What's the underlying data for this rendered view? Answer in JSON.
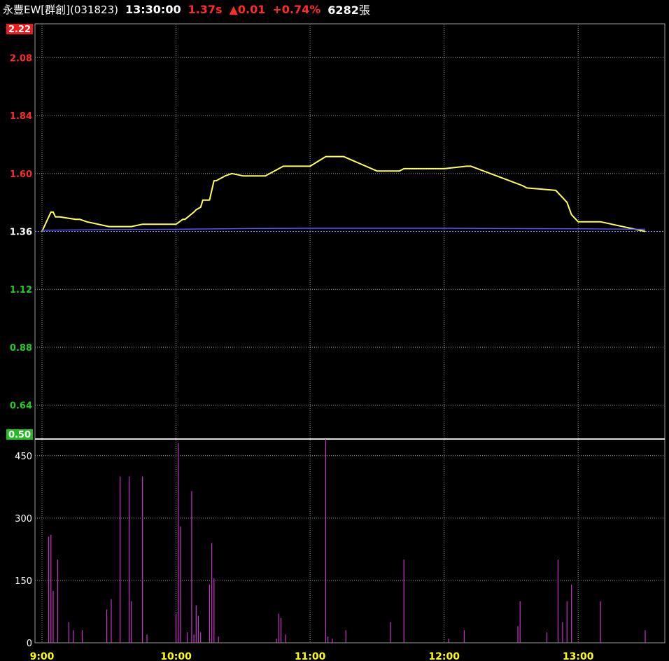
{
  "header": {
    "name": "永豐EW[群創](031823)",
    "time": "13:30:00",
    "price": "1.37s",
    "change_arrow": "▲",
    "change": "0.01",
    "change_pct": "+0.74%",
    "volume": "6282",
    "volume_unit": "張"
  },
  "colors": {
    "up": "#ff2a2a",
    "down": "#22cc22",
    "price_line": "#ffff55",
    "avg_line": "#5555ff",
    "volume_bar": "#cc33cc",
    "grid": "#9a9a9a"
  },
  "chart_data": [
    {
      "type": "line",
      "title": "",
      "x_ticks": [
        "9:00",
        "10:00",
        "11:00",
        "12:00",
        "13:00"
      ],
      "y_ticks": [
        "2.22",
        "2.08",
        "1.84",
        "1.60",
        "1.36",
        "1.12",
        "0.88",
        "0.64",
        "0.50"
      ],
      "ylim": [
        0.5,
        2.22
      ],
      "reference": 1.36,
      "grid": true,
      "series": [
        {
          "role": "price",
          "x": [
            "9:00",
            "9:02",
            "9:04",
            "9:05",
            "9:06",
            "9:08",
            "9:15",
            "9:17",
            "9:20",
            "9:30",
            "9:40",
            "9:45",
            "9:50",
            "10:00",
            "10:03",
            "10:04",
            "10:08",
            "10:09",
            "10:11",
            "10:12",
            "10:15",
            "10:17",
            "10:18",
            "10:22",
            "10:25",
            "10:30",
            "10:40",
            "10:48",
            "10:50",
            "11:00",
            "11:07",
            "11:08",
            "11:15",
            "11:30",
            "11:40",
            "11:42",
            "12:00",
            "12:10",
            "12:12",
            "12:35",
            "12:37",
            "12:50",
            "12:55",
            "12:57",
            "12:59",
            "13:00",
            "13:10",
            "13:30"
          ],
          "values": [
            1.36,
            1.4,
            1.44,
            1.44,
            1.42,
            1.42,
            1.41,
            1.41,
            1.4,
            1.38,
            1.38,
            1.39,
            1.39,
            1.39,
            1.41,
            1.41,
            1.44,
            1.45,
            1.46,
            1.49,
            1.49,
            1.57,
            1.57,
            1.59,
            1.6,
            1.59,
            1.59,
            1.63,
            1.63,
            1.63,
            1.67,
            1.67,
            1.67,
            1.61,
            1.61,
            1.62,
            1.62,
            1.63,
            1.63,
            1.55,
            1.54,
            1.53,
            1.48,
            1.43,
            1.41,
            1.4,
            1.4,
            1.36
          ]
        },
        {
          "role": "average",
          "x": [
            "9:00",
            "9:30",
            "10:00",
            "10:30",
            "11:00",
            "11:30",
            "12:00",
            "12:30",
            "13:00",
            "13:30"
          ],
          "values": [
            1.365,
            1.368,
            1.369,
            1.372,
            1.373,
            1.373,
            1.373,
            1.372,
            1.371,
            1.369
          ]
        }
      ]
    },
    {
      "type": "bar",
      "role": "volume",
      "y_ticks": [
        "450",
        "300",
        "150",
        "0"
      ],
      "ylim": [
        0,
        490
      ],
      "bars": [
        {
          "t": "9:03",
          "v": 255
        },
        {
          "t": "9:04",
          "v": 260
        },
        {
          "t": "9:05",
          "v": 125
        },
        {
          "t": "9:07",
          "v": 200
        },
        {
          "t": "9:12",
          "v": 50
        },
        {
          "t": "9:14",
          "v": 30
        },
        {
          "t": "9:18",
          "v": 30
        },
        {
          "t": "9:29",
          "v": 80
        },
        {
          "t": "9:31",
          "v": 105
        },
        {
          "t": "9:35",
          "v": 400
        },
        {
          "t": "9:39",
          "v": 400
        },
        {
          "t": "9:40",
          "v": 100
        },
        {
          "t": "9:45",
          "v": 400
        },
        {
          "t": "9:47",
          "v": 20
        },
        {
          "t": "10:00",
          "v": 70
        },
        {
          "t": "10:01",
          "v": 480
        },
        {
          "t": "10:02",
          "v": 280
        },
        {
          "t": "10:05",
          "v": 25
        },
        {
          "t": "10:07",
          "v": 365
        },
        {
          "t": "10:08",
          "v": 20
        },
        {
          "t": "10:09",
          "v": 90
        },
        {
          "t": "10:10",
          "v": 65
        },
        {
          "t": "10:11",
          "v": 25
        },
        {
          "t": "10:15",
          "v": 140
        },
        {
          "t": "10:16",
          "v": 240
        },
        {
          "t": "10:17",
          "v": 155
        },
        {
          "t": "10:19",
          "v": 15
        },
        {
          "t": "10:45",
          "v": 10
        },
        {
          "t": "10:46",
          "v": 70
        },
        {
          "t": "10:47",
          "v": 60
        },
        {
          "t": "10:49",
          "v": 20
        },
        {
          "t": "11:07",
          "v": 490
        },
        {
          "t": "11:08",
          "v": 15
        },
        {
          "t": "11:10",
          "v": 10
        },
        {
          "t": "11:16",
          "v": 30
        },
        {
          "t": "11:36",
          "v": 50
        },
        {
          "t": "11:42",
          "v": 200
        },
        {
          "t": "12:02",
          "v": 10
        },
        {
          "t": "12:09",
          "v": 30
        },
        {
          "t": "12:33",
          "v": 40
        },
        {
          "t": "12:34",
          "v": 100
        },
        {
          "t": "12:46",
          "v": 25
        },
        {
          "t": "12:51",
          "v": 200
        },
        {
          "t": "12:53",
          "v": 50
        },
        {
          "t": "12:55",
          "v": 100
        },
        {
          "t": "12:57",
          "v": 140
        },
        {
          "t": "13:10",
          "v": 100
        },
        {
          "t": "13:30",
          "v": 30
        }
      ]
    }
  ]
}
